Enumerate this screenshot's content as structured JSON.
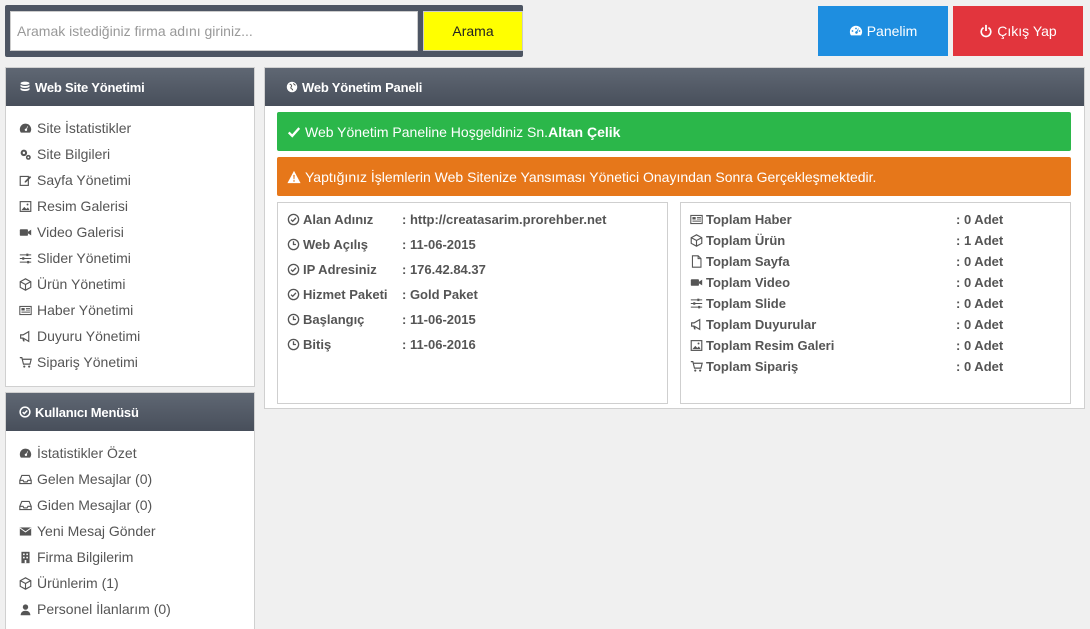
{
  "search": {
    "placeholder": "Aramak istediğiniz firma adını giriniz...",
    "value": "",
    "button_label": "Arama"
  },
  "header_buttons": {
    "panel_label": "Panelim",
    "exit_label": "Çıkış Yap"
  },
  "sidebar": {
    "web_site": {
      "title": "Web Site Yönetimi",
      "items": [
        {
          "label": "Site İstatistikler",
          "icon": "dashboard-icon"
        },
        {
          "label": "Site Bilgileri",
          "icon": "gears-icon"
        },
        {
          "label": "Sayfa Yönetimi",
          "icon": "edit-icon"
        },
        {
          "label": "Resim Galerisi",
          "icon": "image-icon"
        },
        {
          "label": "Video Galerisi",
          "icon": "video-camera-icon"
        },
        {
          "label": "Slider Yönetimi",
          "icon": "sliders-icon"
        },
        {
          "label": "Ürün Yönetimi",
          "icon": "cube-icon"
        },
        {
          "label": "Haber Yönetimi",
          "icon": "newspaper-icon"
        },
        {
          "label": "Duyuru Yönetimi",
          "icon": "bullhorn-icon"
        },
        {
          "label": "Sipariş Yönetimi",
          "icon": "cart-icon"
        }
      ]
    },
    "user_menu": {
      "title": "Kullanıcı Menüsü",
      "items": [
        {
          "label": "İstatistikler Özet",
          "icon": "dashboard-icon"
        },
        {
          "label": "Gelen Mesajlar (0)",
          "icon": "inbox-icon"
        },
        {
          "label": "Giden Mesajlar (0)",
          "icon": "inbox-icon"
        },
        {
          "label": "Yeni Mesaj Gönder",
          "icon": "envelope-icon"
        },
        {
          "label": "Firma Bilgilerim",
          "icon": "building-icon"
        },
        {
          "label": "Ürünlerim (1)",
          "icon": "cube-icon"
        },
        {
          "label": "Personel İlanlarım (0)",
          "icon": "user-icon"
        }
      ]
    }
  },
  "main": {
    "title": "Web Yönetim Paneli",
    "welcome_prefix": "Web Yönetim Paneline Hoşgeldiniz Sn.",
    "welcome_name": "Altan Çelik",
    "warning_text": "Yaptığınız İşlemlerin Web Sitenize Yansıması Yönetici Onayından Sonra Gerçekleşmektedir.",
    "site_info": [
      {
        "label": "Alan Adınız",
        "value": ": http://creatasarim.prorehber.net",
        "icon": "check-circle-icon"
      },
      {
        "label": "Web Açılış",
        "value": ": 11-06-2015",
        "icon": "clock-icon"
      },
      {
        "label": "IP Adresiniz",
        "value": ": 176.42.84.37",
        "icon": "check-circle-icon"
      },
      {
        "label": "Hizmet Paketi",
        "value": ": Gold Paket",
        "icon": "check-circle-icon"
      },
      {
        "label": "Başlangıç",
        "value": ": 11-06-2015",
        "icon": "clock-icon"
      },
      {
        "label": "Bitiş",
        "value": ": 11-06-2016",
        "icon": "clock-icon"
      }
    ],
    "totals": [
      {
        "label": "Toplam Haber",
        "value": ": 0 Adet",
        "icon": "newspaper-icon"
      },
      {
        "label": "Toplam Ürün",
        "value": ": 1 Adet",
        "icon": "cube-icon"
      },
      {
        "label": "Toplam Sayfa",
        "value": ": 0 Adet",
        "icon": "file-icon"
      },
      {
        "label": "Toplam Video",
        "value": ": 0 Adet",
        "icon": "video-camera-icon"
      },
      {
        "label": "Toplam Slide",
        "value": ": 0 Adet",
        "icon": "sliders-icon"
      },
      {
        "label": "Toplam Duyurular",
        "value": ": 0 Adet",
        "icon": "bullhorn-icon"
      },
      {
        "label": "Toplam Resim Galeri",
        "value": ": 0 Adet",
        "icon": "image-icon"
      },
      {
        "label": "Toplam Sipariş",
        "value": ": 0 Adet",
        "icon": "cart-icon"
      }
    ]
  },
  "colors": {
    "search_button": "#ffff00",
    "panel_button": "#1e8ee0",
    "exit_button": "#e2353d",
    "success": "#2bb74a",
    "warning": "#e6771a",
    "header_dark": "#4d5563"
  }
}
